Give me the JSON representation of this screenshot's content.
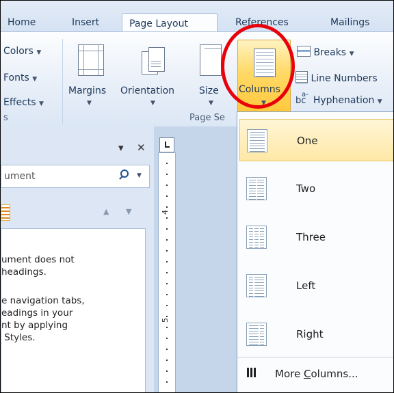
{
  "ribbon_tabs": [
    "Home",
    "Insert",
    "Page Layout",
    "References",
    "Mailings"
  ],
  "ribbon": {
    "themes": {
      "colors": "Colors",
      "fonts": "Fonts",
      "effects": "Effects",
      "group": "s"
    },
    "margins": "Margins",
    "orientation": "Orientation",
    "size": "Size",
    "columns": "Columns",
    "breaks": "Breaks",
    "line_numbers": "Line Numbers",
    "hyphenation": "Hyphenation",
    "hyphenation_glyph": "bc",
    "group_page_setup": "Page Se"
  },
  "nav_pane": {
    "search_text": "ument",
    "close_glyph": "✕",
    "menu_glyph": "▾",
    "message_lines": [
      "ument does not",
      "headings.",
      "",
      "e navigation tabs,",
      "eadings in your",
      "nt by applying",
      " Styles."
    ]
  },
  "ruler": {
    "marks": [
      "4",
      "5"
    ]
  },
  "columns_menu": {
    "items": [
      "One",
      "Two",
      "Three",
      "Left",
      "Right"
    ],
    "selected": "One",
    "more_label_prefix": "More ",
    "more_label_underline": "C",
    "more_label_suffix": "olumns..."
  },
  "colors": {
    "highlight_ring": "#e8000b",
    "selected_fill": "#ffd966",
    "ribbon_bg": "#e4ecf7"
  }
}
